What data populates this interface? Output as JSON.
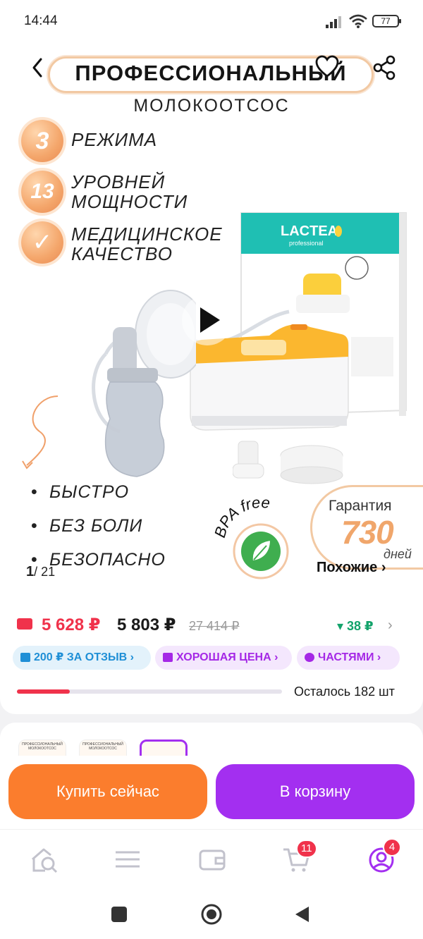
{
  "status_bar": {
    "time": "14:44",
    "battery": "77"
  },
  "hero": {
    "title": "ПРОФЕССИОНАЛЬНЫЙ",
    "subtitle": "МОЛОКООТСОС",
    "features": [
      {
        "badge": "3",
        "text": "РЕЖИМА"
      },
      {
        "badge": "13",
        "text": "УРОВНЕЙ МОЩНОСТИ"
      },
      {
        "badge": "✓",
        "text": "МЕДИЦИНСКОЕ КАЧЕСТВО"
      }
    ],
    "bullets": [
      "БЫСТРО",
      "БЕЗ БОЛИ",
      "БЕЗОПАСНО"
    ],
    "brand": "LACTEA",
    "brand_sub": "professional",
    "bpa_label": "BPA free",
    "guarantee": {
      "title": "Гарантия",
      "value": "730",
      "unit": "дней"
    },
    "counter_current": "1",
    "counter_total": "/ 21",
    "similar_label": "Похожие ›"
  },
  "price": {
    "card_price": "5 628 ₽",
    "price": "5 803 ₽",
    "old_price": "27 414 ₽",
    "discount": "▾ 38 ₽",
    "chips": [
      {
        "label": "200 ₽ ЗА ОТЗЫВ ›",
        "color": "#1f8fd6",
        "bg": "#e3f2fb"
      },
      {
        "label": "ХОРОШАЯ ЦЕНА ›",
        "color": "#a528e6",
        "bg": "#f4e7fd"
      },
      {
        "label": "ЧАСТЯМИ ›",
        "color": "#a528e6",
        "bg": "#f4e7fd"
      }
    ],
    "stock_fraction": 0.2,
    "stock_label": "Осталось 182 шт"
  },
  "gallery": {
    "thumbs": [
      {
        "title": "ПРОФЕССИОНАЛЬНЫЙ",
        "sub": "МОЛОКООТСОС"
      },
      {
        "title": "ПРОФЕССИОНАЛЬНЫЙ",
        "sub": "МОЛОКООТСОС"
      },
      {
        "title": "",
        "sub": ""
      }
    ]
  },
  "actions": {
    "buy_now": "Купить сейчас",
    "add_to_cart": "В корзину",
    "buy_color": "#fb7d2d",
    "cart_color": "#a32ff0"
  },
  "tabbar": {
    "cart_badge": "11",
    "profile_badge": "4"
  }
}
